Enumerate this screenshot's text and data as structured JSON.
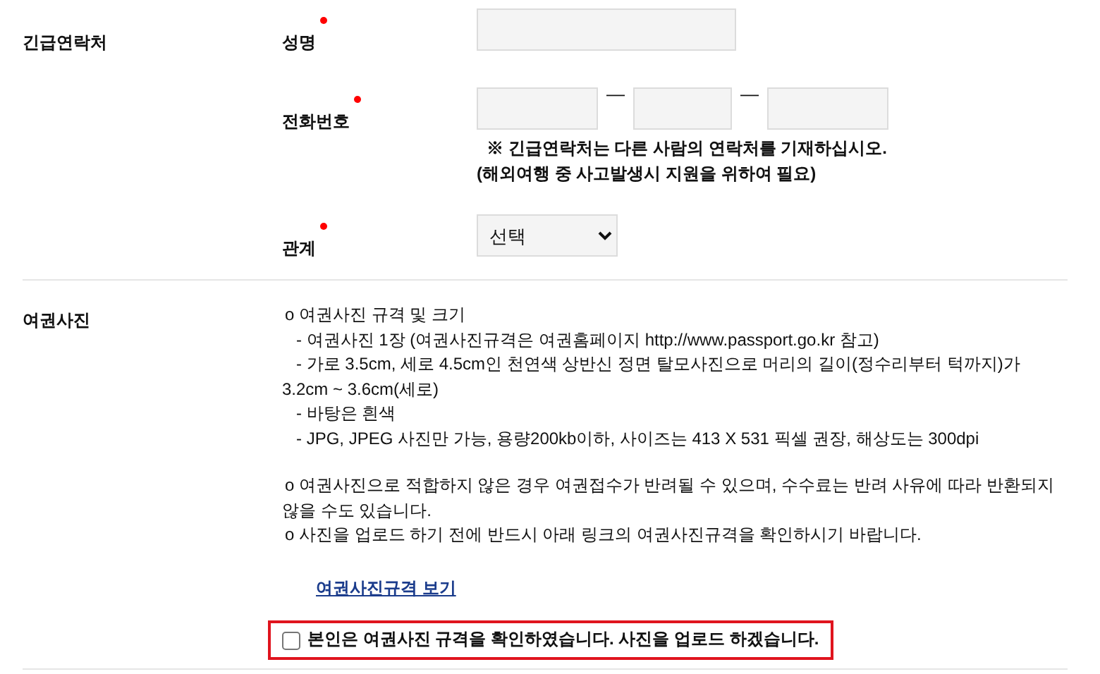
{
  "sections": [
    {
      "label": "긴급연락처",
      "fields": [
        {
          "label": "성명",
          "required": true,
          "kind": "text"
        },
        {
          "label": "전화번호",
          "required": true,
          "kind": "phone",
          "separators": [
            "—",
            "—"
          ],
          "notes": [
            "※ 긴급연락처는 다른 사람의 연락처를 기재하십시오.",
            "(해외여행 중 사고발생시 지원을 위하여 필요)"
          ]
        },
        {
          "label": "관계",
          "required": true,
          "kind": "select",
          "value": "선택"
        }
      ]
    },
    {
      "label": "여권사진",
      "blocks": [
        [
          {
            "kind": "bullet",
            "text": "o  여권사진 규격 및 크기"
          },
          {
            "kind": "dash",
            "text": "- 여권사진 1장 (여권사진규격은 여권홈페이지 http://www.passport.go.kr 참고)"
          },
          {
            "kind": "dash",
            "text": "- 가로 3.5cm, 세로 4.5cm인 천연색 상반신 정면 탈모사진으로 머리의 길이(정수리부터 턱까지)가 3.2cm ~ 3.6cm(세로)"
          },
          {
            "kind": "dash",
            "text": "- 바탕은 흰색"
          },
          {
            "kind": "dash",
            "text": "- JPG, JPEG 사진만 가능, 용량200kb이하, 사이즈는 413 X 531 픽셀 권장, 해상도는 300dpi"
          }
        ],
        [
          {
            "kind": "bullet",
            "text": "o  여권사진으로 적합하지 않은 경우 여권접수가 반려될 수 있으며, 수수료는 반려 사유에 따라 반환되지 않을 수도 있습니다."
          },
          {
            "kind": "bullet",
            "text": "o  사진을 업로드 하기 전에 반드시 아래 링크의 여권사진규격을 확인하시기 바랍니다."
          }
        ]
      ],
      "link": "여권사진규격 보기",
      "consent": {
        "label": "본인은 여권사진 규격을 확인하였습니다. 사진을 업로드 하겠습니다.",
        "checked": false
      }
    }
  ]
}
